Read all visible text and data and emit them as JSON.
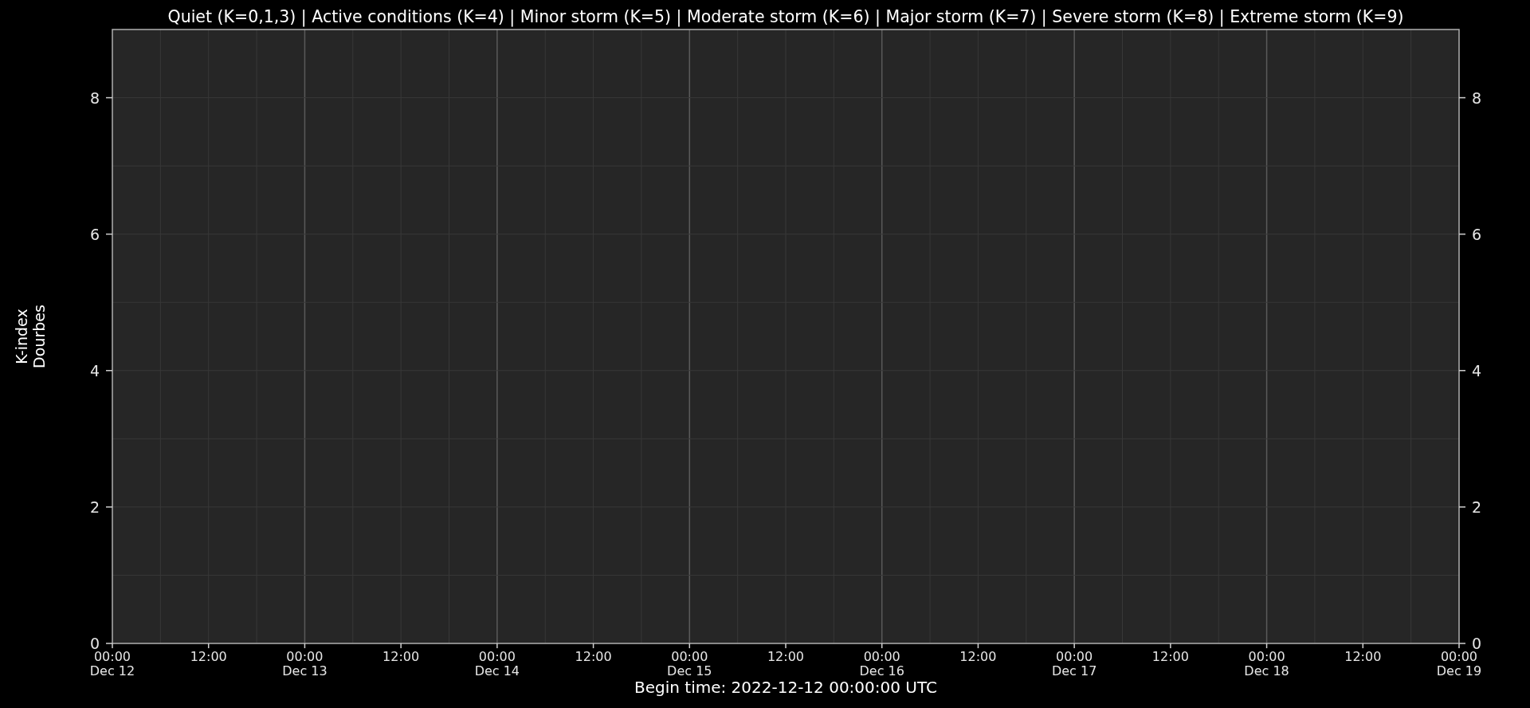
{
  "chart": {
    "chart_data": {
      "type": "bar",
      "title": "Quiet (K=0,1,3) | Active conditions (K=4) | Minor storm (K=5) | Moderate storm (K=6) | Major storm (K=7) | Severe storm (K=8) | Extreme storm (K=9)",
      "xlabel": "Begin time: 2022-12-12 00:00:00 UTC",
      "ylabel": "K-index\nDourbes",
      "xlim": [
        "2022-12-12T00:00:00Z",
        "2022-12-19T00:00:00Z"
      ],
      "ylim": [
        0,
        9
      ],
      "grid": true,
      "yticks": [
        0,
        2,
        4,
        6,
        8
      ],
      "xticks": [
        {
          "value": "2022-12-12T00:00:00Z",
          "label": "00:00\nDec 12"
        },
        {
          "value": "2022-12-12T12:00:00Z",
          "label": "12:00"
        },
        {
          "value": "2022-12-13T00:00:00Z",
          "label": "00:00\nDec 13"
        },
        {
          "value": "2022-12-13T12:00:00Z",
          "label": "12:00"
        },
        {
          "value": "2022-12-14T00:00:00Z",
          "label": "00:00\nDec 14"
        },
        {
          "value": "2022-12-14T12:00:00Z",
          "label": "12:00"
        },
        {
          "value": "2022-12-15T00:00:00Z",
          "label": "00:00\nDec 15"
        },
        {
          "value": "2022-12-15T12:00:00Z",
          "label": "12:00"
        },
        {
          "value": "2022-12-16T00:00:00Z",
          "label": "00:00\nDec 16"
        },
        {
          "value": "2022-12-16T12:00:00Z",
          "label": "12:00"
        },
        {
          "value": "2022-12-17T00:00:00Z",
          "label": "00:00\nDec 17"
        },
        {
          "value": "2022-12-17T12:00:00Z",
          "label": "12:00"
        },
        {
          "value": "2022-12-18T00:00:00Z",
          "label": "00:00\nDec 18"
        },
        {
          "value": "2022-12-18T12:00:00Z",
          "label": "12:00"
        },
        {
          "value": "2022-12-19T00:00:00Z",
          "label": "00:00\nDec 19"
        }
      ]
    },
    "right_axis": {
      "labels": [
        "8",
        "6",
        "4",
        "2",
        "0"
      ]
    }
  }
}
